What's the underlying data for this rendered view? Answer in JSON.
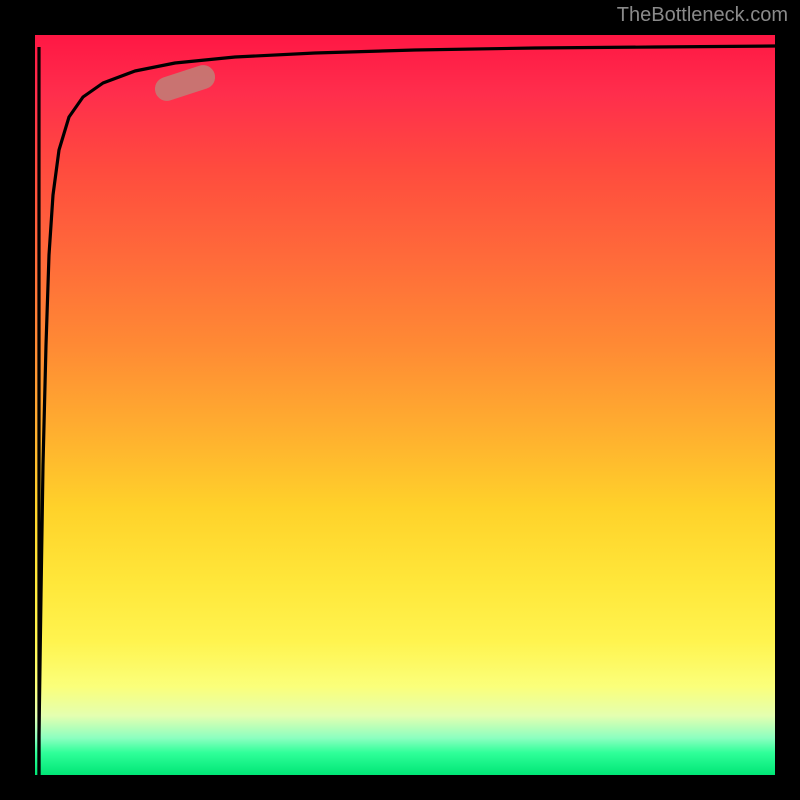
{
  "watermark": "TheBottleneck.com",
  "colors": {
    "background": "#000000",
    "gradient_top": "#ff1744",
    "gradient_mid": "#ffd22a",
    "gradient_bottom": "#00e676",
    "curve": "#000000",
    "marker": "#c47a74",
    "watermark_text": "#8a8a8a"
  },
  "chart_data": {
    "type": "line",
    "title": "",
    "xlabel": "",
    "ylabel": "",
    "xlim": [
      0,
      100
    ],
    "ylim": [
      0,
      100
    ],
    "series": [
      {
        "name": "bottleneck-curve",
        "x": [
          0,
          0.3,
          0.6,
          1,
          1.5,
          2,
          3,
          4,
          6,
          8,
          12,
          16,
          22,
          30,
          40,
          55,
          70,
          85,
          100
        ],
        "y": [
          0,
          20,
          40,
          58,
          70,
          78,
          85,
          88.5,
          91.5,
          93,
          94.5,
          95.3,
          96,
          96.5,
          97,
          97.4,
          97.7,
          97.9,
          98
        ]
      }
    ],
    "annotations": [
      {
        "name": "marker",
        "x_range": [
          16,
          23
        ],
        "y_range": [
          93.5,
          95.5
        ]
      }
    ],
    "grid": false,
    "legend": false
  }
}
